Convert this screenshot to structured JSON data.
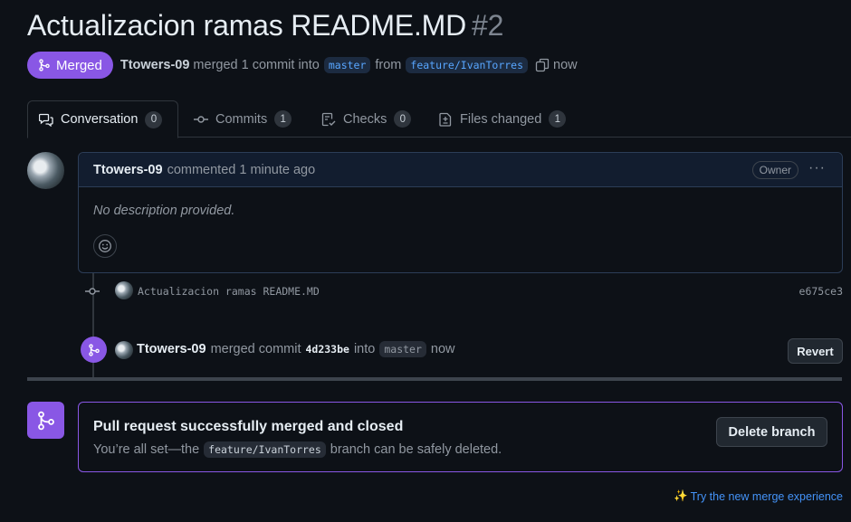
{
  "pr": {
    "title": "Actualizacion ramas README.MD",
    "number": "#2",
    "state_label": "Merged",
    "author": "Ttowers-09",
    "merged_text": "merged 1 commit into",
    "base_branch": "master",
    "from_text": "from",
    "head_branch": "feature/IvanTorres",
    "time": "now"
  },
  "tabs": [
    {
      "label": "Conversation",
      "count": "0",
      "icon": "comment-discussion-icon"
    },
    {
      "label": "Commits",
      "count": "1",
      "icon": "git-commit-icon"
    },
    {
      "label": "Checks",
      "count": "0",
      "icon": "checklist-icon"
    },
    {
      "label": "Files changed",
      "count": "1",
      "icon": "file-diff-icon"
    }
  ],
  "comment": {
    "author": "Ttowers-09",
    "action": "commented 1 minute ago",
    "role": "Owner",
    "menu": "···",
    "body": "No description provided."
  },
  "commit": {
    "message": "Actualizacion ramas README.MD",
    "sha": "e675ce3"
  },
  "merge_event": {
    "author": "Ttowers-09",
    "text": "merged commit",
    "sha": "4d233be",
    "into": "into",
    "branch": "master",
    "time": "now",
    "revert_label": "Revert"
  },
  "merged_status": {
    "title": "Pull request successfully merged and closed",
    "sub_before": "You’re all set—the",
    "branch": "feature/IvanTorres",
    "sub_after": "branch can be safely deleted.",
    "delete_label": "Delete branch"
  },
  "footer": {
    "try_link": "Try the new merge experience",
    "sparkle": "✨"
  },
  "colors": {
    "merged_purple": "#8957e5",
    "link_blue": "#4493f8",
    "background": "#0d1117"
  }
}
